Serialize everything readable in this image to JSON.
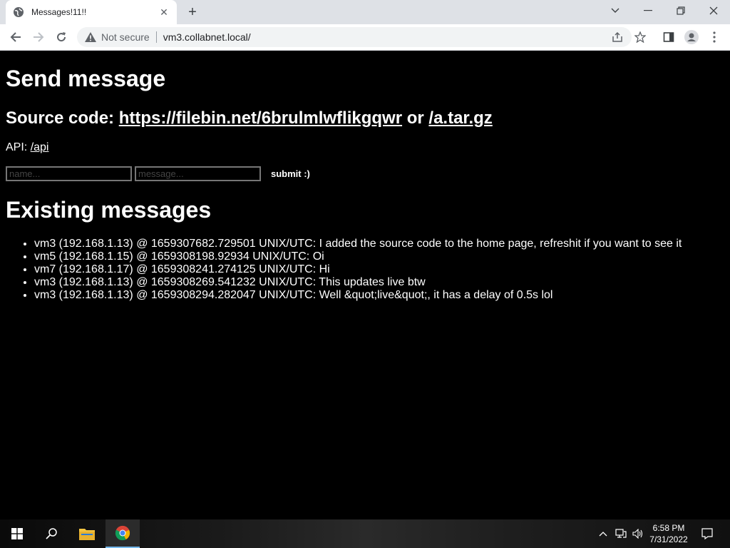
{
  "browser": {
    "tab_title": "Messages!11!!",
    "security_label": "Not secure",
    "url": "vm3.collabnet.local/"
  },
  "page": {
    "heading_send": "Send message",
    "source_prefix": "Source code: ",
    "source_link1": "https://filebin.net/6brulmlwflikgqwr",
    "source_or": " or ",
    "source_link2": "/a.tar.gz",
    "api_prefix": "API: ",
    "api_link": "/api",
    "name_placeholder": "name...",
    "message_placeholder": "message...",
    "submit_label": "submit :)",
    "heading_existing": "Existing messages",
    "messages": [
      "vm3 (192.168.1.13) @ 1659307682.729501 UNIX/UTC: I added the source code to the home page, refreshit if you want to see it",
      "vm5 (192.168.1.15) @ 1659308198.92934 UNIX/UTC: Oi",
      "vm7 (192.168.1.17) @ 1659308241.274125 UNIX/UTC: Hi",
      "vm3 (192.168.1.13) @ 1659308269.541232 UNIX/UTC: This updates live btw",
      "vm3 (192.168.1.13) @ 1659308294.282047 UNIX/UTC: Well &quot;live&quot;, it has a delay of 0.5s lol"
    ]
  },
  "taskbar": {
    "time": "6:58 PM",
    "date": "7/31/2022"
  }
}
